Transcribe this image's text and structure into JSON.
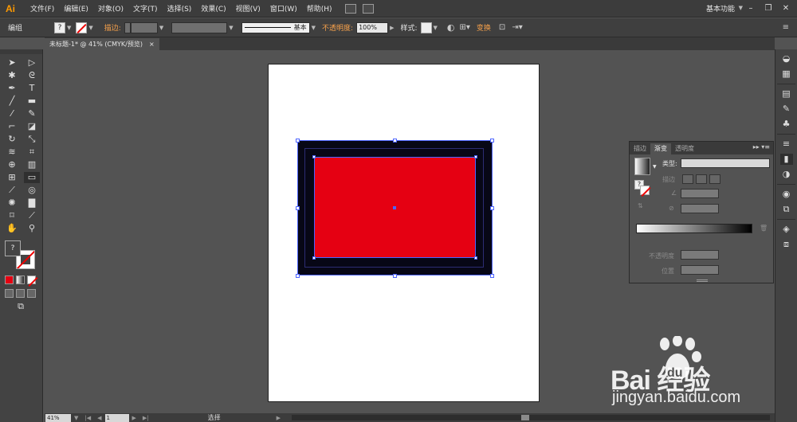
{
  "app": {
    "logo": "Ai"
  },
  "menu": [
    "文件(F)",
    "编辑(E)",
    "对象(O)",
    "文字(T)",
    "选择(S)",
    "效果(C)",
    "视图(V)",
    "窗口(W)",
    "帮助(H)"
  ],
  "workspace": "基本功能",
  "window_buttons": [
    "–",
    "❐",
    "✕"
  ],
  "control": {
    "selection_label": "编组",
    "fill_glyph": "?",
    "stroke_label": "描边:",
    "stroke_style": "基本",
    "opacity_label": "不透明度:",
    "opacity_value": "100%",
    "style_label": "样式:",
    "transform_label": "变换"
  },
  "document_tab": {
    "title": "未标题-1* @ 41% (CMYK/预览)",
    "close": "×"
  },
  "fill_stroke": {
    "fill_glyph": "?"
  },
  "gradient_panel": {
    "tabs": [
      "描边",
      "渐变",
      "透明度"
    ],
    "type_label": "类型:",
    "stroke_label": "描边",
    "opacity_label": "不透明度",
    "position_label": "位置",
    "stroke_glyph": "?",
    "menu_glyph": "▸▸ ▾≡"
  },
  "status": {
    "zoom": "41%",
    "page": "1",
    "tool": "选择"
  },
  "watermark": {
    "brand": "Bai 经验",
    "du": "du",
    "url": "jingyan.baidu.com"
  },
  "colors": {
    "selection_blue": "#4d64ff",
    "object_red": "#e50012",
    "object_dark": "#070716",
    "accent_orange": "#f7a14b"
  },
  "icons": {
    "toolbox": [
      "selection-tool-icon",
      "direct-selection-tool-icon",
      "magic-wand-tool-icon",
      "lasso-tool-icon",
      "pen-tool-icon",
      "type-tool-icon",
      "line-tool-icon",
      "rectangle-tool-icon",
      "paintbrush-tool-icon",
      "pencil-tool-icon",
      "blob-brush-tool-icon",
      "eraser-tool-icon",
      "rotate-tool-icon",
      "scale-tool-icon",
      "warp-tool-icon",
      "free-transform-tool-icon",
      "shape-builder-tool-icon",
      "perspective-grid-tool-icon",
      "mesh-tool-icon",
      "gradient-tool-icon",
      "eyedropper-tool-icon",
      "blend-tool-icon",
      "symbol-sprayer-tool-icon",
      "column-graph-tool-icon",
      "artboard-tool-icon",
      "slice-tool-icon",
      "hand-tool-icon",
      "zoom-tool-icon"
    ]
  }
}
